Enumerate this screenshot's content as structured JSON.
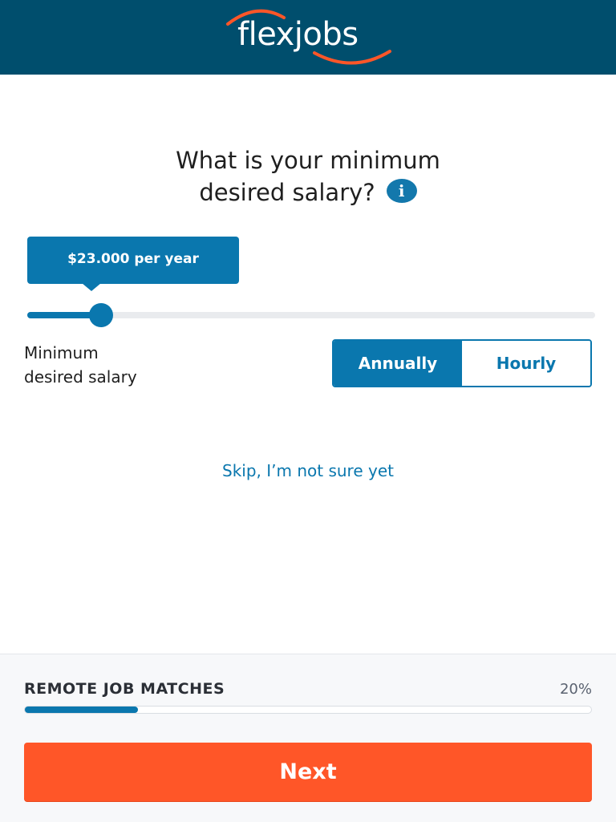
{
  "header": {
    "logo_text": "flexjobs",
    "brand_color": "#004e6d",
    "accent_color": "#ff5628"
  },
  "question": {
    "line1": "What is your minimum",
    "line2": "desired salary?",
    "info_icon": "info-icon"
  },
  "salary": {
    "tooltip": "$23.000 per year",
    "slider_value_fraction": 0.13,
    "min_label": "Minimum\ndesired salary"
  },
  "toggle": {
    "annually_label": "Annually",
    "hourly_label": "Hourly",
    "selected": "Annually"
  },
  "skip_label": "Skip, I’m not sure yet",
  "footer": {
    "title": "REMOTE JOB MATCHES",
    "percent_text": "20%",
    "progress_fraction": 0.2,
    "next_label": "Next"
  }
}
